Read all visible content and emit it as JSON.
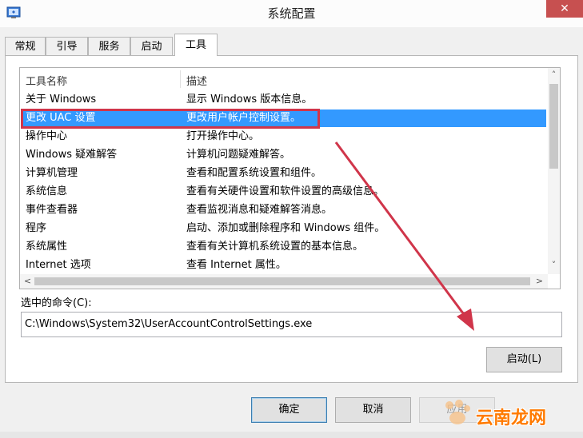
{
  "window": {
    "title": "系统配置",
    "close_glyph": "✕"
  },
  "tabs": [
    {
      "label": "常规"
    },
    {
      "label": "引导"
    },
    {
      "label": "服务"
    },
    {
      "label": "启动"
    },
    {
      "label": "工具",
      "active": true
    }
  ],
  "list": {
    "headers": [
      "工具名称",
      "描述"
    ],
    "rows": [
      {
        "name": "关于 Windows",
        "desc": "显示 Windows 版本信息。"
      },
      {
        "name": "更改 UAC 设置",
        "desc": "更改用户帐户控制设置。",
        "selected": true
      },
      {
        "name": "操作中心",
        "desc": "打开操作中心。"
      },
      {
        "name": "Windows 疑难解答",
        "desc": "计算机问题疑难解答。"
      },
      {
        "name": "计算机管理",
        "desc": "查看和配置系统设置和组件。"
      },
      {
        "name": "系统信息",
        "desc": "查看有关硬件设置和软件设置的高级信息。"
      },
      {
        "name": "事件查看器",
        "desc": "查看监视消息和疑难解答消息。"
      },
      {
        "name": "程序",
        "desc": "启动、添加或删除程序和 Windows 组件。"
      },
      {
        "name": "系统属性",
        "desc": "查看有关计算机系统设置的基本信息。"
      },
      {
        "name": "Internet 选项",
        "desc": "查看 Internet 属性。"
      }
    ]
  },
  "scroll": {
    "up": "˄",
    "down": "˅",
    "left": "<",
    "right": ">"
  },
  "command": {
    "label": "选中的命令(C):",
    "value": "C:\\Windows\\System32\\UserAccountControlSettings.exe"
  },
  "buttons": {
    "launch": "启动(L)",
    "ok": "确定",
    "cancel": "取消",
    "apply": "应用"
  },
  "watermark": {
    "text": "云南龙网"
  },
  "colors": {
    "selection": "#3399ff",
    "annotation": "#d0354a",
    "watermark": "#ff7a00"
  },
  "icons": {
    "app": "msconfig-icon",
    "close": "close-icon"
  }
}
